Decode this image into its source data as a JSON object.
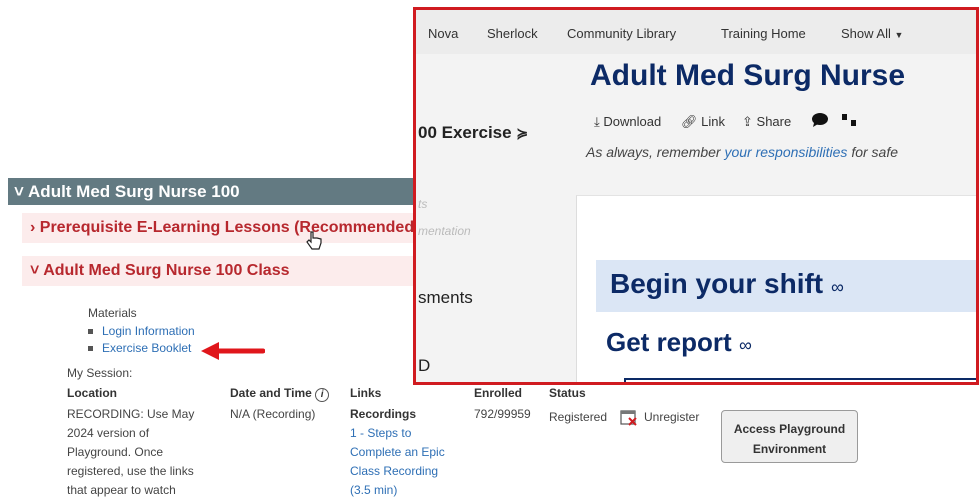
{
  "course": {
    "title": "Adult Med Surg Nurse 100",
    "prereq_label": "Prerequisite E-Learning Lessons (Recommended)",
    "class_label": "Adult Med Surg Nurse 100 Class"
  },
  "materials": {
    "heading": "Materials",
    "items": [
      "Login Information",
      "Exercise Booklet"
    ]
  },
  "session": {
    "heading": "My Session:",
    "columns": [
      "Location",
      "Date and Time",
      "Links",
      "Enrolled",
      "Status"
    ],
    "location_lines": [
      "RECORDING: Use May",
      "2024 version of",
      "Playground. Once",
      "registered, use the links",
      "that appear to watch"
    ],
    "date": "N/A (Recording)",
    "links_heading": "Recordings",
    "link_lines": [
      "1 - Steps to",
      "Complete an Epic",
      "Class Recording",
      "(3.5 min)"
    ],
    "enrolled": "792/99959",
    "status": "Registered",
    "unregister": "Unregister",
    "access_button": [
      "Access Playground",
      "Environment"
    ]
  },
  "overlay": {
    "nav": [
      "Nova",
      "Sherlock",
      "Community Library",
      "Training Home",
      "Show All"
    ],
    "page_title": "Adult Med Surg Nurse",
    "sidebar_heading": "00 Exercise",
    "sidebar_faded": [
      "ts",
      "mentation"
    ],
    "sidebar_items": [
      "sments",
      "D"
    ],
    "tools": [
      "Download",
      "Link",
      "Share"
    ],
    "note_prefix": "As always, remember ",
    "note_link": "your responsibilities",
    "note_suffix": " for safe",
    "section1": "Begin your shift",
    "section2": "Get report"
  },
  "colors": {
    "header": "#637a82",
    "section_text": "#b7282e",
    "section_bg": "#fcecec",
    "link": "#2e6fb5",
    "overlay_border": "#d01b20",
    "title_navy": "#0c2a66"
  }
}
